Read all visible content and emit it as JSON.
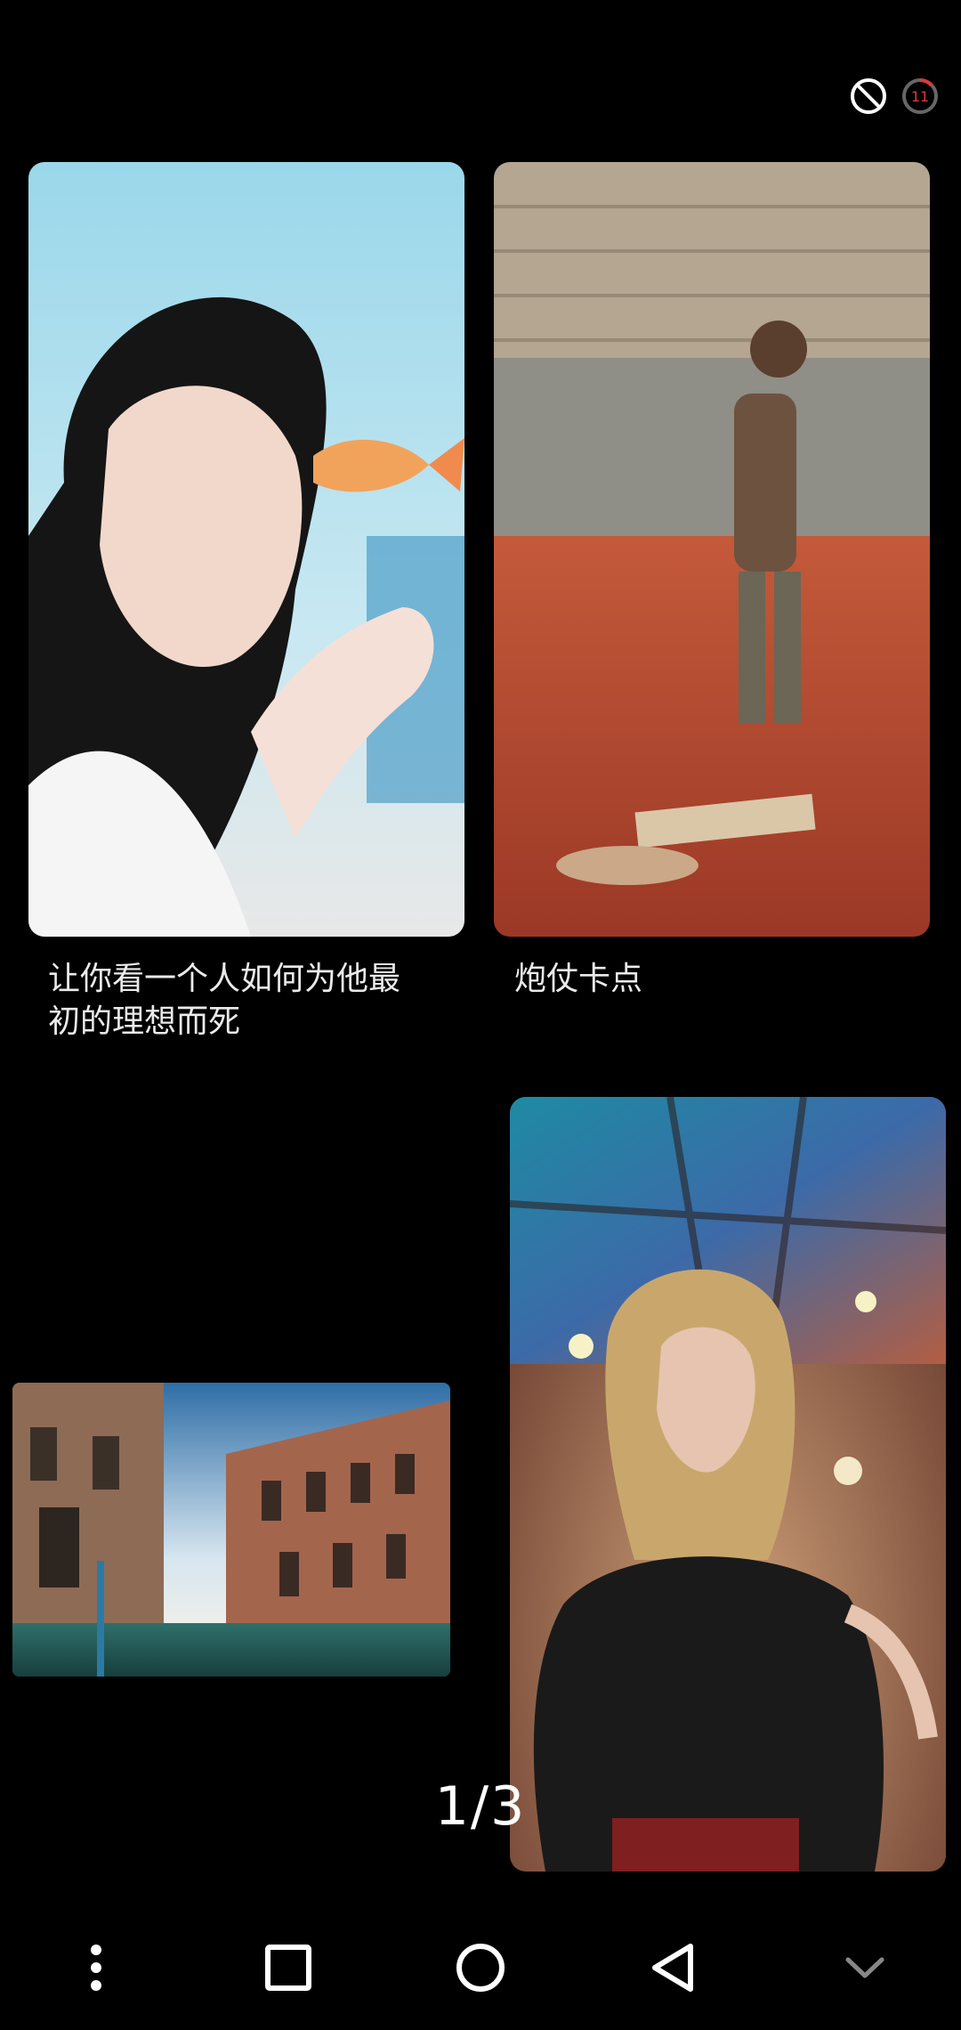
{
  "status": {
    "icons": [
      "block-icon",
      "timer-icon"
    ],
    "timer_value": "11"
  },
  "cards": [
    {
      "caption": "让你看一个人如何为他最\n初的理想而死",
      "image": "girl-with-goldfish"
    },
    {
      "caption": "炮仗卡点",
      "image": "man-in-fireworks-debris"
    },
    {
      "caption": "",
      "image": "venice-canal"
    },
    {
      "caption": "",
      "image": "woman-under-stained-glass-dome"
    }
  ],
  "page_indicator": "1/3",
  "nav": {
    "items": [
      "menu-dots-icon",
      "recents-square-icon",
      "home-circle-icon",
      "back-triangle-icon",
      "collapse-chevron-icon"
    ]
  },
  "colors": {
    "background": "#000000",
    "timer_accent": "#d93a3a"
  }
}
